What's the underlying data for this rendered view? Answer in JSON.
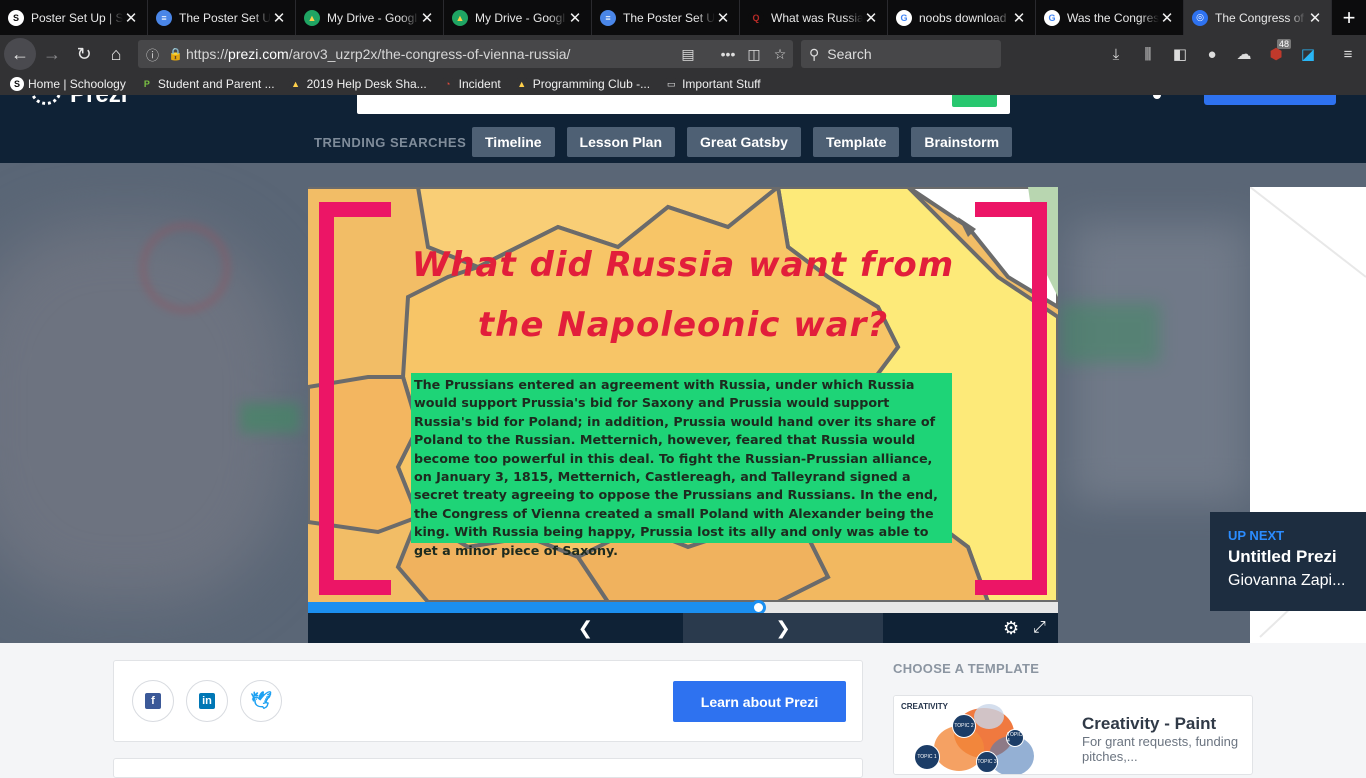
{
  "browser": {
    "tabs": [
      {
        "title": "Poster Set Up | S",
        "icon": "schoology-icon",
        "color": "#ffffff",
        "fg": "#0c0c0d",
        "glyph": "S"
      },
      {
        "title": "The Poster Set U",
        "icon": "google-docs-icon",
        "color": "#4a86e8",
        "fg": "#ffffff",
        "glyph": "≡"
      },
      {
        "title": "My Drive - Googl",
        "icon": "google-drive-icon",
        "color": "#1fa463",
        "fg": "#ffd04b",
        "glyph": "▲"
      },
      {
        "title": "My Drive - Googl",
        "icon": "google-drive-icon",
        "color": "#1fa463",
        "fg": "#ffd04b",
        "glyph": "▲"
      },
      {
        "title": "The Poster Set U",
        "icon": "google-docs-icon",
        "color": "#4a86e8",
        "fg": "#ffffff",
        "glyph": "≡"
      },
      {
        "title": "What was Russia",
        "icon": "quora-icon",
        "color": "#0c0c0d",
        "fg": "#b92b27",
        "glyph": "Q"
      },
      {
        "title": "noobs download",
        "icon": "google-icon",
        "color": "#ffffff",
        "fg": "#4285f4",
        "glyph": "G"
      },
      {
        "title": "Was the Congres",
        "icon": "google-icon",
        "color": "#ffffff",
        "fg": "#4285f4",
        "glyph": "G"
      },
      {
        "title": "The Congress of",
        "icon": "prezi-icon",
        "color": "#2e72f0",
        "fg": "#ffffff",
        "glyph": "◎"
      }
    ],
    "url_host": "prezi.com",
    "url_prefix": "https://",
    "url_path": "/arov3_uzrp2x/the-congress-of-vienna-russia/",
    "search_placeholder": "Search",
    "extension_badge": "48",
    "bookmarks": [
      {
        "label": "Home | Schoology",
        "icon": "schoology-icon",
        "color": "#ffffff",
        "fg": "#0c0c0d",
        "glyph": "S"
      },
      {
        "label": "Student and Parent ...",
        "icon": "pearson-icon",
        "color": "#323234",
        "fg": "#7bc143",
        "glyph": "P"
      },
      {
        "label": "2019 Help Desk Sha...",
        "icon": "google-drive-icon",
        "color": "#323234",
        "fg": "#ffd04b",
        "glyph": "▲"
      },
      {
        "label": "Incident",
        "icon": "incident-icon",
        "color": "#323234",
        "fg": "#e04a3a",
        "glyph": "◔"
      },
      {
        "label": "Programming Club -...",
        "icon": "google-drive-icon",
        "color": "#323234",
        "fg": "#ffd04b",
        "glyph": "▲"
      },
      {
        "label": "Important Stuff",
        "icon": "folder-icon",
        "color": "#323234",
        "fg": "#e8e8e8",
        "glyph": "▭"
      }
    ]
  },
  "prezi": {
    "logo_text": "Prezi",
    "trending_label": "TRENDING SEARCHES",
    "trending": [
      "Timeline",
      "Lesson Plan",
      "Great Gatsby",
      "Template",
      "Brainstorm"
    ],
    "slide_title_line1": "What did Russia want from",
    "slide_title_line2": "the Napoleonic war?",
    "slide_body": "The Prussians entered an agreement with Russia, under which Russia would support Prussia's bid for Saxony and Prussia would support Russia's bid for Poland; in addition, Prussia would hand over its share of Poland to the Russian. Metternich, however, feared that Russia would become too powerful in this deal. To fight the Russian-Prussian alliance, on January 3, 1815, Metternich, Castlereagh, and Talleyrand signed a secret treaty agreeing to oppose the Prussians and Russians. In the end, the Congress of Vienna created a small Poland with Alexander being the king. With Russia being happy, Prussia lost its ally and only was able to get a minor piece of Saxony.",
    "progress": 0.6,
    "up_next_label": "UP NEXT",
    "up_next_title": "Untitled Prezi",
    "up_next_author": "Giovanna Zapi...",
    "learn_button": "Learn about Prezi",
    "choose_template_label": "CHOOSE A TEMPLATE",
    "template_thumb_title": "CREATIVITY",
    "template_name": "Creativity - Paint",
    "template_desc": "For grant requests, funding pitches,...",
    "template_topics": [
      "TOPIC 1",
      "TOPIC 2",
      "TOPIC 3",
      "TOPIC 4"
    ]
  },
  "colors": {
    "accent": "#2e72f0",
    "header": "#0f2236",
    "slide_bracket": "#ec1566",
    "slide_title": "#e21e3b",
    "slide_box": "#1ed477",
    "progress": "#1b8ff0"
  }
}
